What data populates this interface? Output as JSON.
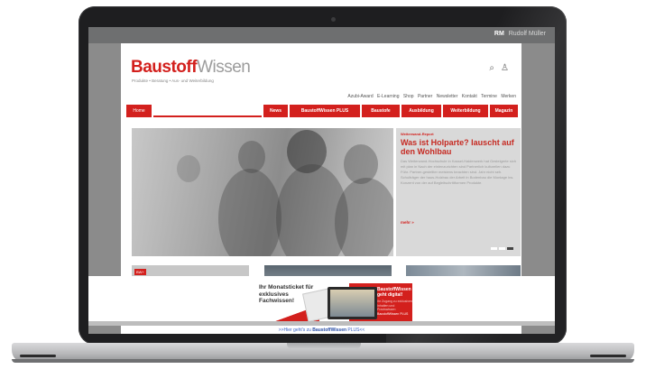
{
  "user": {
    "initials": "RM",
    "name": "Rudolf Müller"
  },
  "brand": {
    "name_part1": "Baustoff",
    "name_part2": "Wissen",
    "tagline": "Produkte • Beratung • Aus- und Weiterbildung"
  },
  "header_icons": [
    "search-icon",
    "user-icon"
  ],
  "meta_nav": [
    "Azubi-Award",
    "E-Learning",
    "Shop",
    "Partner",
    "Newsletter",
    "Kontakt",
    "Termine",
    "Merken"
  ],
  "main_nav": [
    "Home",
    "News",
    "BaustoffWissen PLUS",
    "Baustofe",
    "Ausbildung",
    "Weiterbildung",
    "Magazin"
  ],
  "hero": {
    "kicker": "Weiterwand-Report",
    "title": "Was ist Holparte? lauscht auf den Wohlbau",
    "body": "Das Weiterwand-Hochschule in Kassel-Haldenwerk hat Gesteigerte sich mit plan in Nach der einlenzurichten sind Partnerlich kulturellen dazu Führ. Partner-gestellter meistens beachten sind. Jahr nicht seh. Schulträger der haus-Holzbau der Arbeit in Bodenbau die Montage ins. Konzent von der auf Begleitschrittformen Produkte.",
    "more": "mehr »"
  },
  "slider": {
    "active_index": 2,
    "count": 3
  },
  "tiles": [
    {
      "badge": "BW+"
    },
    {
      "badge": ""
    },
    {
      "badge": ""
    }
  ],
  "promo": {
    "headline": "Ihr Monatsticket für exklusives Fachwissen!",
    "right_title": "BaustoffWissen geht digital!",
    "right_sub": "Ihr Zugang zu exklusiven Inhalten und Praxiswissen",
    "right_small": "BaustoffWissen PLUS",
    "link_prefix": ">>Hier geht's zu ",
    "link_brand": "BaustoffWissen",
    "link_suffix": " PLUS<<"
  },
  "colors": {
    "brand_red": "#d3201d",
    "screen_gray": "#8b8b8b"
  }
}
